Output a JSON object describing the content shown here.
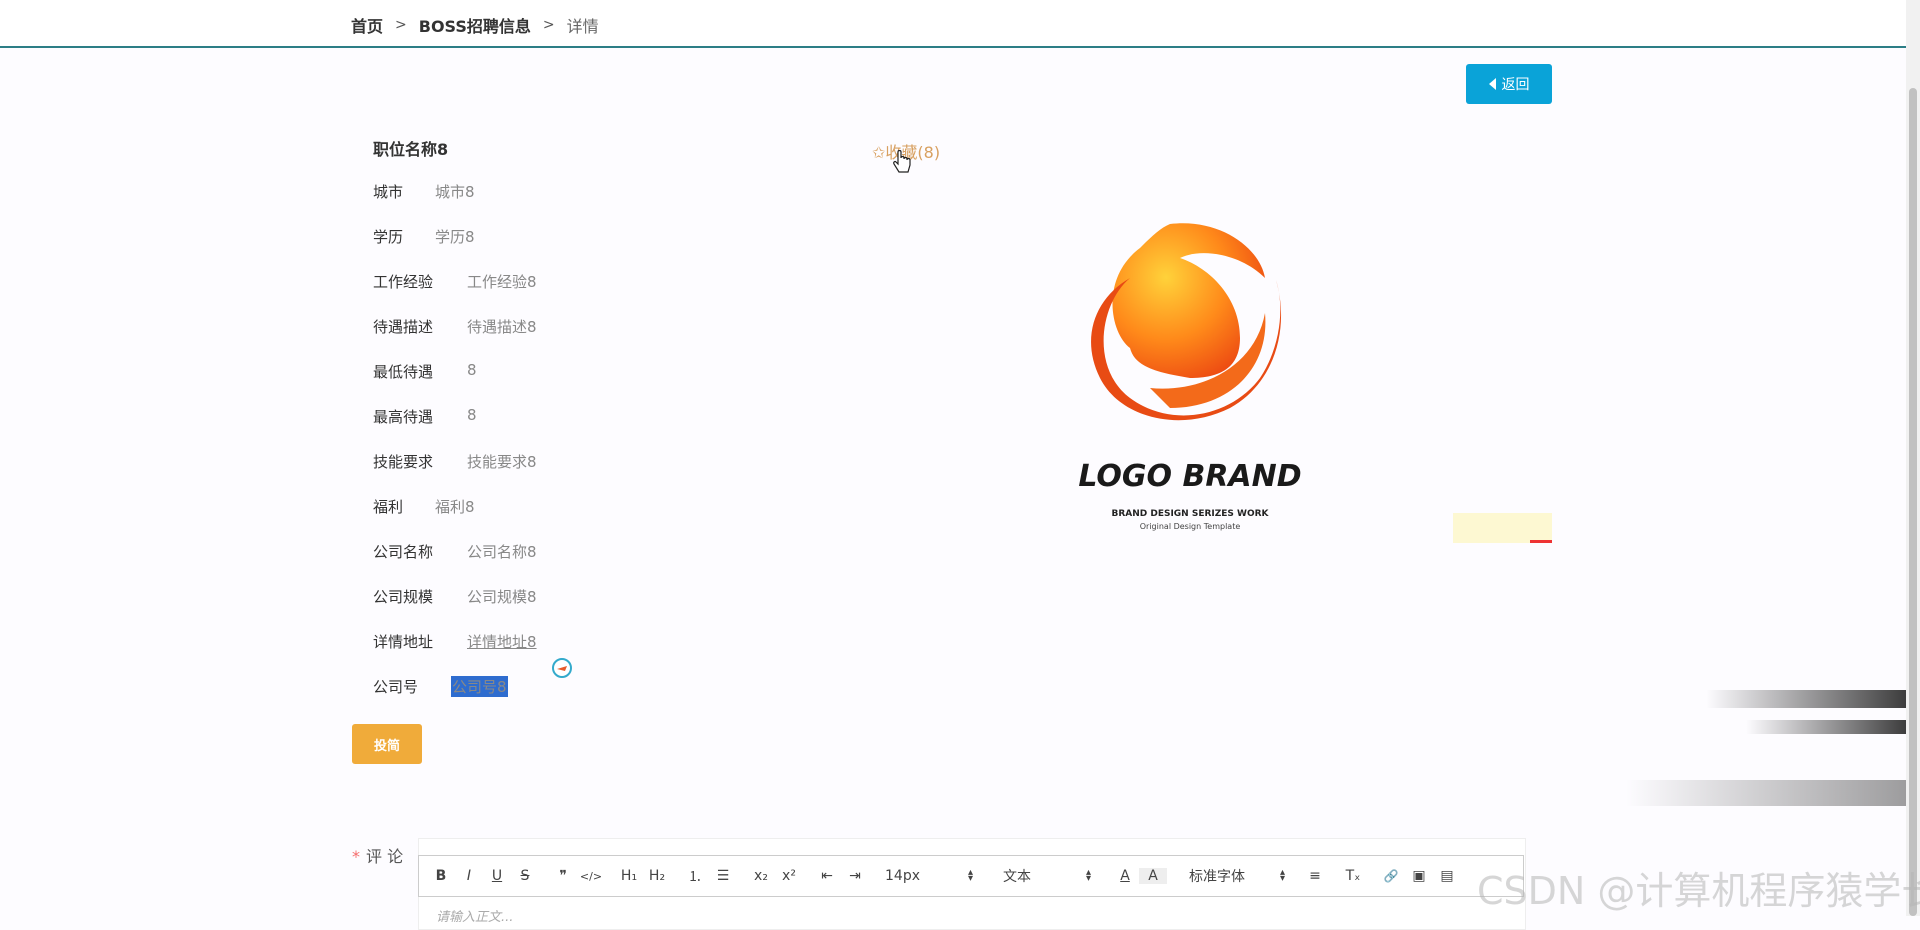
{
  "breadcrumb": {
    "home": "首页",
    "sep1": ">",
    "list": "BOSS招聘信息",
    "sep2": ">",
    "current": "详情"
  },
  "back_button": {
    "label": "返回"
  },
  "job": {
    "title": "职位名称8",
    "favorite": "✩收藏(8)",
    "fields": [
      {
        "label": "城市",
        "value": "城市8"
      },
      {
        "label": "学历",
        "value": "学历8"
      },
      {
        "label": "工作经验",
        "value": "工作经验8"
      },
      {
        "label": "待遇描述",
        "value": "待遇描述8"
      },
      {
        "label": "最低待遇",
        "value": "8"
      },
      {
        "label": "最高待遇",
        "value": "8"
      },
      {
        "label": "技能要求",
        "value": "技能要求8"
      },
      {
        "label": "福利",
        "value": "福利8"
      },
      {
        "label": "公司名称",
        "value": "公司名称8"
      },
      {
        "label": "公司规模",
        "value": "公司规模8"
      },
      {
        "label": "详情地址",
        "value": "详情地址8"
      },
      {
        "label": "公司号",
        "value": "公司号8"
      }
    ]
  },
  "logo": {
    "title": "LOGO BRAND",
    "subtitle": "BRAND DESIGN SERIZES WORK",
    "tagline": "Original Design Template"
  },
  "apply_button": {
    "label": "投简"
  },
  "comment": {
    "required_mark": "*",
    "label": "评 论",
    "placeholder": "请输入正文...",
    "toolbar": {
      "bold": "B",
      "italic": "I",
      "underline": "U",
      "strike": "S",
      "quote": "❞",
      "code": "</>",
      "h1": "H₁",
      "h2": "H₂",
      "ordered": "⒈",
      "bullet": "☰",
      "sub": "x₂",
      "sup": "x²",
      "outdent": "⇤",
      "indent": "⇥",
      "size": "14px",
      "format": "文本",
      "color": "A",
      "bg": "A",
      "font": "标准字体",
      "align": "≡",
      "clean": "Tₓ",
      "link": "🔗",
      "image": "▣",
      "video": "▤"
    }
  },
  "watermark": "CSDN @计算机程序猿学长",
  "colors": {
    "accent": "#0aa3d8",
    "apply": "#f0ab3a",
    "topline": "#2c7e86",
    "favorite": "#d8a060"
  }
}
